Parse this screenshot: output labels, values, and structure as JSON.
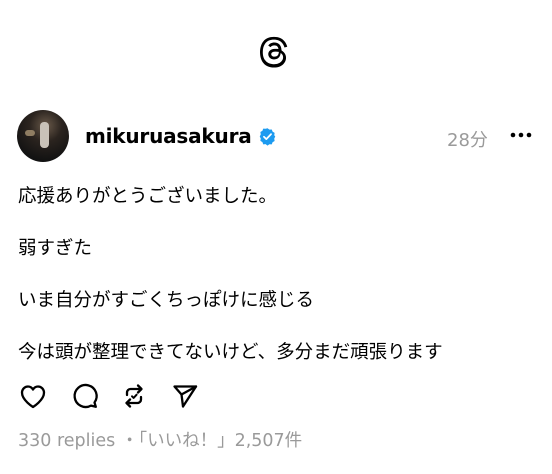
{
  "app": {
    "logo_icon": "threads-logo-icon"
  },
  "post": {
    "username": "mikuruasakura",
    "verified": true,
    "time": "28分",
    "lines": [
      "応援ありがとうございました。",
      "弱すぎた",
      "いま自分がすごくちっぽけに感じる",
      "今は頭が整理できてないけど、多分まだ頑張ります"
    ],
    "actions": [
      "heart-icon",
      "comment-icon",
      "repost-icon",
      "share-icon"
    ],
    "stats": "330 replies ・「いいね！」2,507件"
  },
  "colors": {
    "verified_blue": "#1d9bf0",
    "muted": "#9a9a9a"
  }
}
